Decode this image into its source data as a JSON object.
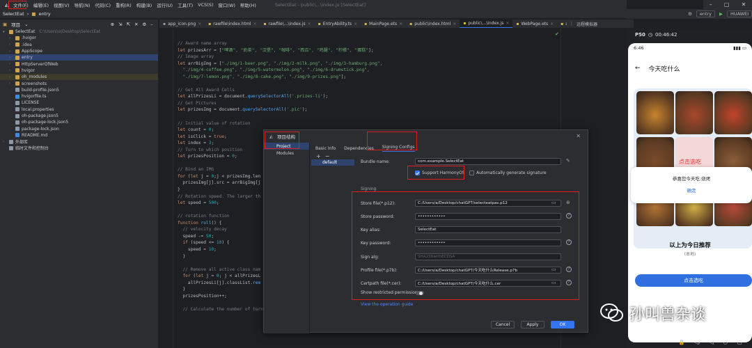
{
  "menu": {
    "items": [
      "文件(F)",
      "编辑(E)",
      "视图(V)",
      "导航(N)",
      "代码(C)",
      "重构(R)",
      "构建(B)",
      "运行(U)",
      "工具(T)",
      "VCS(S)",
      "窗口(W)",
      "帮助(H)"
    ],
    "window_title": "SelectEat - public\\...\\index.js [SelectEat]"
  },
  "breadcrumb": [
    "SelectEat",
    "entry"
  ],
  "run": {
    "config": "entry",
    "device": "HUAWEI"
  },
  "tree": {
    "header": "项目",
    "rows": [
      {
        "level": 0,
        "arrow": "▾",
        "label": "SelectEat",
        "extra": "C:\\Users\\a\\Desktop\\SelectEat",
        "icon": "#d0a44c",
        "sel": false
      },
      {
        "level": 1,
        "arrow": "›",
        "label": ".hvigor",
        "icon": "#d0a44c",
        "sel": false
      },
      {
        "level": 1,
        "arrow": "›",
        "label": ".idea",
        "icon": "#d0a44c",
        "sel": false
      },
      {
        "level": 1,
        "arrow": "›",
        "label": "AppScope",
        "icon": "#d0a44c",
        "sel": false
      },
      {
        "level": 1,
        "arrow": "›",
        "label": "entry",
        "icon": "#d0a44c",
        "sel": true
      },
      {
        "level": 1,
        "arrow": "›",
        "label": "HttpServerOfWeb",
        "icon": "#d0a44c",
        "sel": false
      },
      {
        "level": 1,
        "arrow": "›",
        "label": "hvigor",
        "icon": "#d0a44c",
        "sel": false
      },
      {
        "level": 1,
        "arrow": "›",
        "label": "oh_modules",
        "icon": "#c8a23e",
        "sel": false,
        "hl": true
      },
      {
        "level": 1,
        "arrow": "›",
        "label": "screenshots",
        "icon": "#d0a44c",
        "sel": false
      },
      {
        "level": 1,
        "arrow": "",
        "label": "build-profile.json5",
        "icon": "#8d99a6",
        "sel": false
      },
      {
        "level": 1,
        "arrow": "",
        "label": "hvigorfile.ts",
        "icon": "#3f8be0",
        "sel": false
      },
      {
        "level": 1,
        "arrow": "",
        "label": "LICENSE",
        "icon": "#8d99a6",
        "sel": false
      },
      {
        "level": 1,
        "arrow": "",
        "label": "local.properties",
        "icon": "#8d99a6",
        "sel": false
      },
      {
        "level": 1,
        "arrow": "",
        "label": "oh-package.json5",
        "icon": "#8d99a6",
        "sel": false
      },
      {
        "level": 1,
        "arrow": "",
        "label": "oh-package-lock.json5",
        "icon": "#8d99a6",
        "sel": false
      },
      {
        "level": 1,
        "arrow": "",
        "label": "package-lock.json",
        "icon": "#8d99a6",
        "sel": false
      },
      {
        "level": 1,
        "arrow": "",
        "label": "README.md",
        "icon": "#3f8be0",
        "sel": false
      },
      {
        "level": 0,
        "arrow": "›",
        "label": "外部库",
        "icon": "#8d99a6",
        "sel": false
      },
      {
        "level": 0,
        "arrow": "",
        "label": "临时文件和控制台",
        "icon": "#8d99a6",
        "sel": false
      }
    ]
  },
  "tabs": [
    {
      "label": "app_icon.png",
      "active": false
    },
    {
      "label": "rawfile\\index.html",
      "active": false
    },
    {
      "label": "rawfile\\...\\index.js",
      "active": false
    },
    {
      "label": "EntryAbility.ts",
      "active": false
    },
    {
      "label": "MainPage.ets",
      "active": false
    },
    {
      "label": "public\\index.html",
      "active": false
    },
    {
      "label": "public\\...\\index.js",
      "active": true
    },
    {
      "label": "WebPage.ets",
      "active": false
    },
    {
      "label": "ap...",
      "active": false
    }
  ],
  "right_tool": "远程模拟器",
  "code": [
    [
      [
        "cm",
        "// Award name array"
      ]
    ],
    [
      [
        "kw",
        "let "
      ],
      [
        "tx",
        "prizesArr = ["
      ],
      [
        "st",
        "\"啤酒\", \"奶茶\", \"汉堡\", \"咖啡\", \"西瓜\", \"鸡腿\", \"柠檬\", \"蛋糕\""
      ],
      [
        "tx",
        "];"
      ]
    ],
    [
      [
        "cm",
        "// Image array"
      ]
    ],
    [
      [
        "kw",
        "let "
      ],
      [
        "tx",
        "arrBigImg = ["
      ],
      [
        "st",
        "\"./img/1-beer.png\", \"./img/2-milk.png\", \"./img/3-hamburg.png\","
      ]
    ],
    [
      [
        "st",
        "  \"./img/4-coffee.png\", \"./img/5-watermelon.png\", \"./img/6-drumstick.png\","
      ]
    ],
    [
      [
        "st",
        "  \"./img/7-lemon.png\", \"./img/8-cake.png\", \"./img/9-prizes.png\""
      ],
      [
        "tx",
        "];"
      ]
    ],
    [
      [
        "tx",
        ""
      ]
    ],
    [
      [
        "cm",
        "// Get All Award Cells"
      ]
    ],
    [
      [
        "kw",
        "let "
      ],
      [
        "tx",
        "allPrizesLi = document."
      ],
      [
        "fn",
        "querySelectorAll"
      ],
      [
        "tx",
        "("
      ],
      [
        "st",
        "'.prizes-li'"
      ],
      [
        "tx",
        ");"
      ]
    ],
    [
      [
        "cm",
        "// Get Pictures"
      ]
    ],
    [
      [
        "kw",
        "let "
      ],
      [
        "tx",
        "prizesImg = document."
      ],
      [
        "fn",
        "querySelectorAll"
      ],
      [
        "tx",
        "("
      ],
      [
        "st",
        "'.pic'"
      ],
      [
        "tx",
        ");"
      ]
    ],
    [
      [
        "tx",
        ""
      ]
    ],
    [
      [
        "cm",
        "// Initial value of rotation"
      ]
    ],
    [
      [
        "kw",
        "let "
      ],
      [
        "tx",
        "count = "
      ],
      [
        "nu",
        "0"
      ],
      [
        "tx",
        ";"
      ]
    ],
    [
      [
        "kw",
        "let "
      ],
      [
        "tx",
        "isClick = "
      ],
      [
        "kw",
        "true"
      ],
      [
        "tx",
        ";"
      ]
    ],
    [
      [
        "kw",
        "let "
      ],
      [
        "tx",
        "index = "
      ],
      [
        "nu",
        "3"
      ],
      [
        "tx",
        ";"
      ]
    ],
    [
      [
        "cm",
        "// Turn to which position"
      ]
    ],
    [
      [
        "kw",
        "let "
      ],
      [
        "tx",
        "prizesPosition = "
      ],
      [
        "nu",
        "0"
      ],
      [
        "tx",
        ";"
      ]
    ],
    [
      [
        "tx",
        ""
      ]
    ],
    [
      [
        "cm",
        "// Bind an IMG"
      ]
    ],
    [
      [
        "kw",
        "for "
      ],
      [
        "tx",
        "("
      ],
      [
        "kw",
        "let "
      ],
      [
        "tx",
        "j = "
      ],
      [
        "nu",
        "0"
      ],
      [
        "tx",
        ";j < prizesImg.len"
      ]
    ],
    [
      [
        "tx",
        "  prizesImg[j].src = arrBigImg[j"
      ]
    ],
    [
      [
        "tx",
        "}"
      ]
    ],
    [
      [
        "cm",
        "// Rotation speed. The larger th"
      ]
    ],
    [
      [
        "kw",
        "let "
      ],
      [
        "tx",
        "speed = "
      ],
      [
        "nu",
        "500"
      ],
      [
        "tx",
        ";"
      ]
    ],
    [
      [
        "tx",
        ""
      ]
    ],
    [
      [
        "cm",
        "// rotation function"
      ]
    ],
    [
      [
        "kw",
        "function "
      ],
      [
        "fn",
        "roll"
      ],
      [
        "tx",
        "() {"
      ]
    ],
    [
      [
        "cm",
        "  // velocity decay"
      ]
    ],
    [
      [
        "tx",
        "  speed -= "
      ],
      [
        "nu",
        "50"
      ],
      [
        "tx",
        ";"
      ]
    ],
    [
      [
        "kw",
        "  if "
      ],
      [
        "tx",
        "(speed <= "
      ],
      [
        "nu",
        "10"
      ],
      [
        "tx",
        ") {"
      ]
    ],
    [
      [
        "tx",
        "    speed = "
      ],
      [
        "nu",
        "10"
      ],
      [
        "tx",
        ";"
      ]
    ],
    [
      [
        "tx",
        "  }"
      ]
    ],
    [
      [
        "tx",
        ""
      ]
    ],
    [
      [
        "cm",
        "  // Remove all active class nam"
      ]
    ],
    [
      [
        "kw",
        "  for "
      ],
      [
        "tx",
        "("
      ],
      [
        "kw",
        "let "
      ],
      [
        "tx",
        "j = "
      ],
      [
        "nu",
        "0"
      ],
      [
        "tx",
        "; j < allPrizesL"
      ]
    ],
    [
      [
        "tx",
        "    allPrizesLi[j].classList."
      ],
      [
        "fn",
        "rem"
      ]
    ],
    [
      [
        "tx",
        "  }"
      ]
    ],
    [
      [
        "tx",
        "  prizesPosition++;"
      ]
    ],
    [
      [
        "tx",
        ""
      ]
    ],
    [
      [
        "cm",
        "  // Calculate the number of turns"
      ]
    ]
  ],
  "dialog": {
    "title": "项目结构",
    "nav": [
      {
        "label": "Project",
        "sel": true
      },
      {
        "label": "Modules",
        "sel": false
      }
    ],
    "tabs": [
      {
        "label": "Basic Info",
        "active": false
      },
      {
        "label": "Dependencies",
        "active": false
      },
      {
        "label": "Signing Configs",
        "active": true
      }
    ],
    "module_toolbar": [
      "+",
      "−"
    ],
    "modules": [
      "default"
    ],
    "bundle_label": "Bundle name:",
    "bundle_value": "com.example.SelectEat",
    "support_harmonyos": "Support HarmonyOS",
    "auto_sign": "Automatically generate signature",
    "signing_header": "Signing",
    "fields": [
      {
        "label": "Store file(*.p12):",
        "value": "C:/Users/a/Desktop/chatGPT/selecteatpas.p12",
        "icons": [
          "folder",
          "fingerprint"
        ],
        "disabled": false
      },
      {
        "label": "Store password:",
        "value": "••••••••••••",
        "icons": [
          "help"
        ],
        "disabled": false
      },
      {
        "label": "Key alias:",
        "value": "SelectEat",
        "icons": [],
        "disabled": false
      },
      {
        "label": "Key password:",
        "value": "••••••••••••",
        "icons": [
          "help"
        ],
        "disabled": false
      },
      {
        "label": "Sign alg:",
        "value": "SHA256withECDSA",
        "icons": [],
        "disabled": true
      },
      {
        "label": "Profile file(*.p7b):",
        "value": "C:/Users/a/Desktop/chatGPT/今天吃什么Release.p7b",
        "icons": [
          "folder",
          "help"
        ],
        "disabled": false
      },
      {
        "label": "Certpath file(*.cer):",
        "value": "C:/Users/a/Desktop/chatGPT/今天吃什么.cer",
        "icons": [
          "folder",
          "help"
        ],
        "disabled": false
      }
    ],
    "show_restricted": "Show restricted permissions",
    "view_guide": "View the operation guide",
    "buttons": {
      "cancel": "Cancel",
      "apply": "Apply",
      "ok": "OK"
    }
  },
  "emulator": {
    "device": "P50",
    "time": "00:46:42",
    "status_time": "6:46",
    "app_title": "今天吃什么",
    "pick_label": "点击选吃",
    "popup_text": "恭喜您今天吃:烧烤",
    "popup_ok": "确定",
    "result": "以上为今日推荐",
    "result_sub": "(本地)",
    "pick_button": "点击选吃"
  },
  "watermark": "孙叫兽杂谈",
  "colors": {
    "accent": "#3574f0",
    "annotation": "#e02020",
    "editor_bg": "#1e1f22",
    "panel_bg": "#2b2d30"
  }
}
